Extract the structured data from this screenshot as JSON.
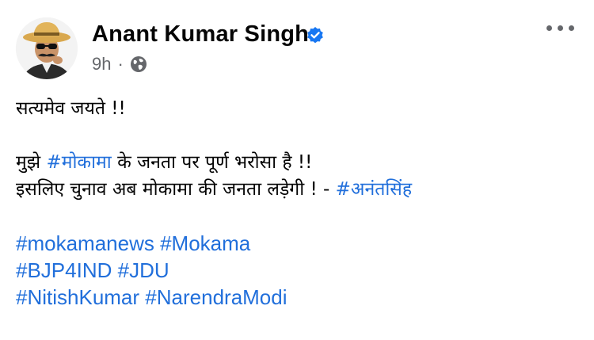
{
  "post": {
    "author": "Anant Kumar Singh",
    "verified": true,
    "time": "9h",
    "separator": "·",
    "audience_icon": "globe-icon",
    "more_icon": "more-options-icon"
  },
  "body": {
    "line1": "सत्यमेव जयते !!",
    "line2_before": "मुझे ",
    "line2_tag": "#मोकामा",
    "line2_after": " के जनता पर पूर्ण भरोसा है !!",
    "line3_before": "इसलिए चुनाव अब मोकामा की जनता लड़ेगी ! - ",
    "line3_tag": "#अनंतसिंह",
    "hashtags_row1": [
      "#mokamanews",
      "#Mokama"
    ],
    "hashtags_row2": [
      "#BJP4IND",
      "#JDU"
    ],
    "hashtags_row3": [
      "#NitishKumar",
      "#NarendraModi"
    ]
  },
  "colors": {
    "link": "#216fdb",
    "secondary_text": "#65676b",
    "verified_badge": "#1877f2"
  }
}
